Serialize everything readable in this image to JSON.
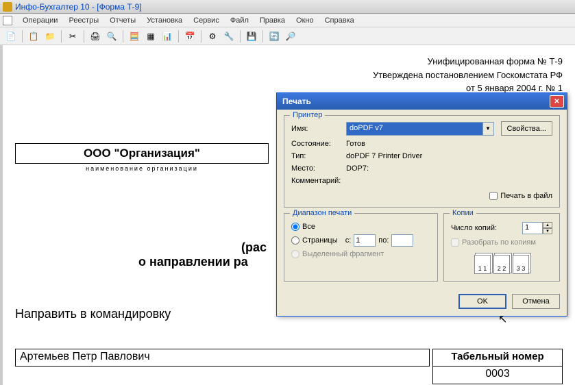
{
  "app": {
    "title": "Инфо-Бухгалтер 10 - [Форма Т-9]"
  },
  "menu": {
    "items": [
      "Операции",
      "Реестры",
      "Отчеты",
      "Установка",
      "Сервис",
      "Файл",
      "Правка",
      "Окно",
      "Справка"
    ]
  },
  "document": {
    "header_l1": "Унифицированная форма № Т-9",
    "header_l2": "Утверждена постановлением Госкомстата РФ",
    "header_l3": "от 5 января 2004 г. № 1",
    "org_name": "ООО \"Организация\"",
    "org_caption": "наименование организации",
    "title_l1": "(рас",
    "title_l2": "о направлении ра",
    "send_text": "Направить в командировку",
    "employee_name": "Артемьев Петр Павлович",
    "tab_header": "Табельный номер",
    "tab_value": "0003"
  },
  "print_dialog": {
    "title": "Печать",
    "printer_legend": "Принтер",
    "labels": {
      "name": "Имя:",
      "state": "Состояние:",
      "type": "Тип:",
      "place": "Место:",
      "comment": "Комментарий:"
    },
    "values": {
      "name": "doPDF v7",
      "state": "Готов",
      "type": "doPDF 7 Printer Driver",
      "place": "DOP7:",
      "comment": ""
    },
    "properties_btn": "Свойства...",
    "print_to_file": "Печать в файл",
    "range_legend": "Диапазон печати",
    "range": {
      "all": "Все",
      "pages": "Страницы",
      "from_lbl": "с:",
      "to_lbl": "по:",
      "from_val": "1",
      "to_val": "",
      "selection": "Выделенный фрагмент"
    },
    "copies_legend": "Копии",
    "copies": {
      "count_lbl": "Число копий:",
      "count": "1",
      "collate": "Разобрать по копиям"
    },
    "ok": "OK",
    "cancel": "Отмена"
  }
}
